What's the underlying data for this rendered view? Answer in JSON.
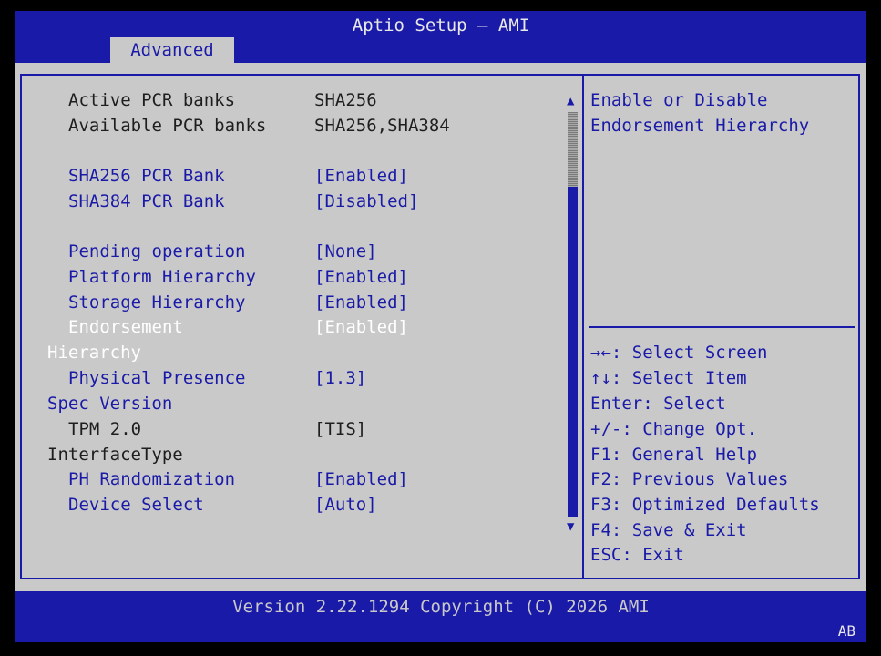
{
  "header": {
    "title": "Aptio Setup – AMI",
    "tab": "Advanced"
  },
  "settings": {
    "active_pcr_label": "Active PCR banks",
    "active_pcr_value": "SHA256",
    "available_pcr_label": "Available PCR banks",
    "available_pcr_value": "SHA256,SHA384",
    "sha256_label": "SHA256 PCR Bank",
    "sha256_value": "[Enabled]",
    "sha384_label": "SHA384 PCR Bank",
    "sha384_value": "[Disabled]",
    "pending_label": "Pending operation",
    "pending_value": "[None]",
    "platform_label": "Platform Hierarchy",
    "platform_value": "[Enabled]",
    "storage_label": "Storage Hierarchy",
    "storage_value": "[Enabled]",
    "endorsement_label_1": "Endorsement",
    "endorsement_label_2": "Hierarchy",
    "endorsement_value": "[Enabled]",
    "physical_label_1": "Physical Presence",
    "physical_label_2": "Spec Version",
    "physical_value": "[1.3]",
    "tpm_label_1": "TPM 2.0",
    "tpm_label_2": "InterfaceType",
    "tpm_value": "[TIS]",
    "ph_label": "PH Randomization",
    "ph_value": "[Enabled]",
    "device_label": "Device Select",
    "device_value": "[Auto]"
  },
  "help": {
    "desc_1": "Enable or Disable",
    "desc_2": "Endorsement Hierarchy",
    "keys": [
      "→←: Select Screen",
      "↑↓: Select Item",
      "Enter: Select",
      "+/-: Change Opt.",
      "F1: General Help",
      "F2: Previous Values",
      "F3: Optimized Defaults",
      "F4: Save & Exit",
      "ESC: Exit"
    ]
  },
  "footer": {
    "version": "Version 2.22.1294 Copyright (C) 2026 AMI",
    "badge": "AB"
  },
  "icons": {
    "scroll_up": "up-triangle",
    "scroll_down": "down-triangle"
  },
  "colors": {
    "bios_blue": "#1a1aa8",
    "panel_gray": "#c9c9c9",
    "selected_text": "#ffffff"
  }
}
